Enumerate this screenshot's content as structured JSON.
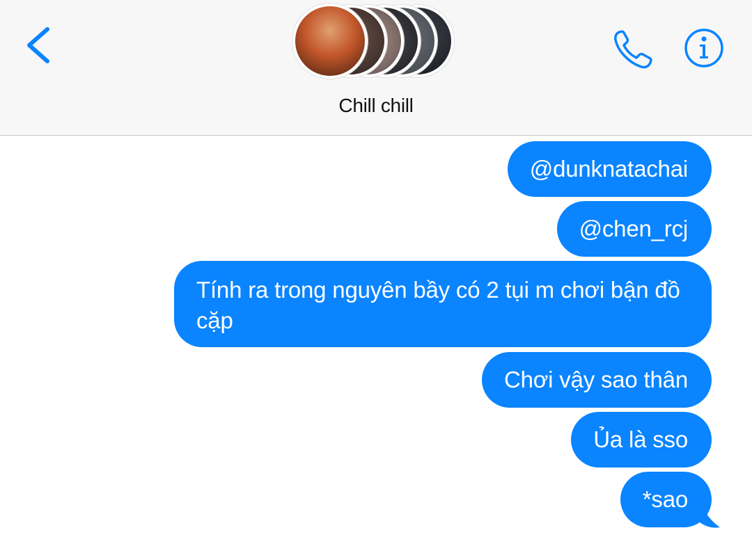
{
  "header": {
    "group_name": "Chill chill",
    "back_icon": "chevron-left-icon",
    "phone_icon": "phone-icon",
    "info_icon": "info-icon",
    "accent_color": "#0a84ff",
    "avatars": [
      {
        "name": "avatar-1",
        "color": "#c2562a"
      },
      {
        "name": "avatar-2",
        "color": "#3a2c28"
      },
      {
        "name": "avatar-3",
        "color": "#6b5b57"
      },
      {
        "name": "avatar-4",
        "color": "#2a2a30"
      },
      {
        "name": "avatar-5",
        "color": "#4a4e55"
      },
      {
        "name": "avatar-6",
        "color": "#1e2228"
      }
    ]
  },
  "messages": [
    {
      "text": "@dunknatachai",
      "sender": "me"
    },
    {
      "text": "@chen_rcj",
      "sender": "me"
    },
    {
      "text": "Tính ra trong nguyên bầy có 2 tụi m chơi bận đồ cặp",
      "sender": "me"
    },
    {
      "text": "Chơi vậy sao thân",
      "sender": "me"
    },
    {
      "text": "Ủa là sso",
      "sender": "me"
    },
    {
      "text": "*sao",
      "sender": "me"
    }
  ],
  "bubble_color": "#0a84ff"
}
